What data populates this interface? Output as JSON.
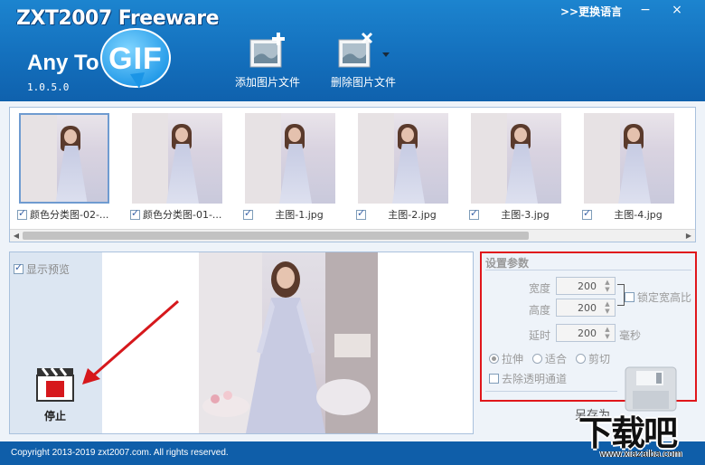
{
  "window": {
    "title_brand": "ZXT2007 Freeware",
    "logo_prefix": "Any To",
    "logo_word": "GIF",
    "version": "1.0.5.0",
    "change_language": ">>更换语言",
    "minimize_symbol": "−",
    "close_symbol": "×"
  },
  "toolbar": {
    "add_label": "添加图片文件",
    "remove_label": "删除图片文件"
  },
  "thumbnails": [
    {
      "name": "颜色分类图-02-...",
      "checked": true,
      "selected": true
    },
    {
      "name": "颜色分类图-01-...",
      "checked": true,
      "selected": false
    },
    {
      "name": "主图-1.jpg",
      "checked": true,
      "selected": false
    },
    {
      "name": "主图-2.jpg",
      "checked": true,
      "selected": false
    },
    {
      "name": "主图-3.jpg",
      "checked": true,
      "selected": false
    },
    {
      "name": "主图-4.jpg",
      "checked": true,
      "selected": false
    }
  ],
  "preview": {
    "show_preview_label": "显示预览",
    "show_preview_checked": true,
    "stop_label": "停止"
  },
  "settings": {
    "title": "设置参数",
    "width_label": "宽度",
    "width_value": "200",
    "height_label": "高度",
    "height_value": "200",
    "lock_ratio_label": "锁定宽高比",
    "delay_label": "延时",
    "delay_value": "200",
    "delay_unit": "毫秒",
    "mode_stretch": "拉伸",
    "mode_fit": "适合",
    "mode_crop": "剪切",
    "mode_selected": "stretch",
    "remove_alpha_label": "去除透明通道",
    "save_as_label": "另存为"
  },
  "footer": {
    "copyright": "Copyright 2013-2019 zxt2007.com. All rights reserved."
  },
  "watermark": {
    "main": "下载吧",
    "url": "www.xiazaiba.com"
  },
  "colors": {
    "header_blue": "#1470bd",
    "footer_blue": "#0f5ea9",
    "highlight_red": "#e0161b",
    "panel_bg": "#eef3f9"
  }
}
